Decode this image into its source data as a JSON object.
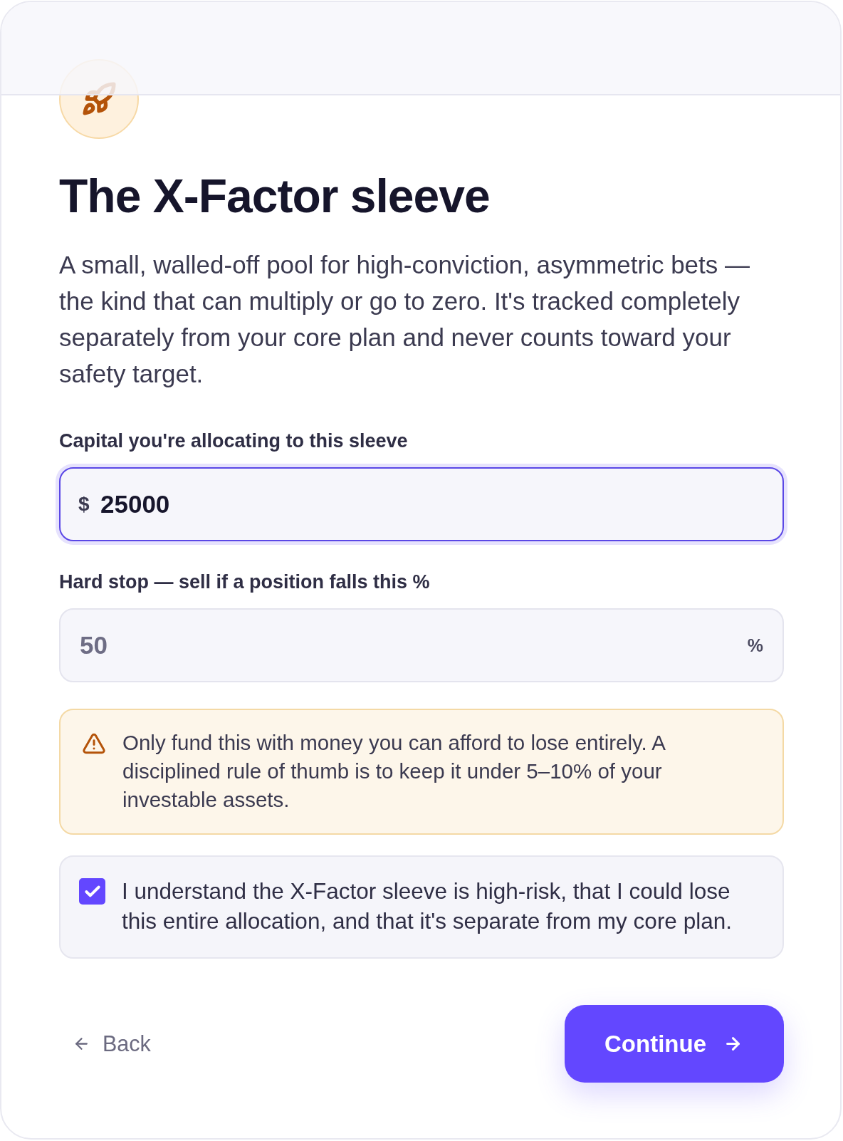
{
  "title": "The X-Factor sleeve",
  "description": "A small, walled-off pool for high-conviction, asymmetric bets — the kind that can multiply or go to zero. It's tracked completely separately from your core plan and never counts toward your safety target.",
  "fields": [
    {
      "label": "Capital you're allocating to this sleeve",
      "prefix": "$",
      "value": "25000",
      "focused": true
    },
    {
      "label": "Hard stop — sell if a position falls this %",
      "placeholder": "50",
      "suffix": "%",
      "focused": false
    }
  ],
  "warning": {
    "text": "Only fund this with money you can afford to lose entirely. A disciplined rule of thumb is to keep it under 5–10% of your investable assets."
  },
  "acknowledgement": {
    "checked": true,
    "text": "I understand the X-Factor sleeve is high-risk, that I could lose this entire allocation, and that it's separate from my core plan."
  },
  "actions": {
    "back": "Back",
    "continue": "Continue"
  }
}
